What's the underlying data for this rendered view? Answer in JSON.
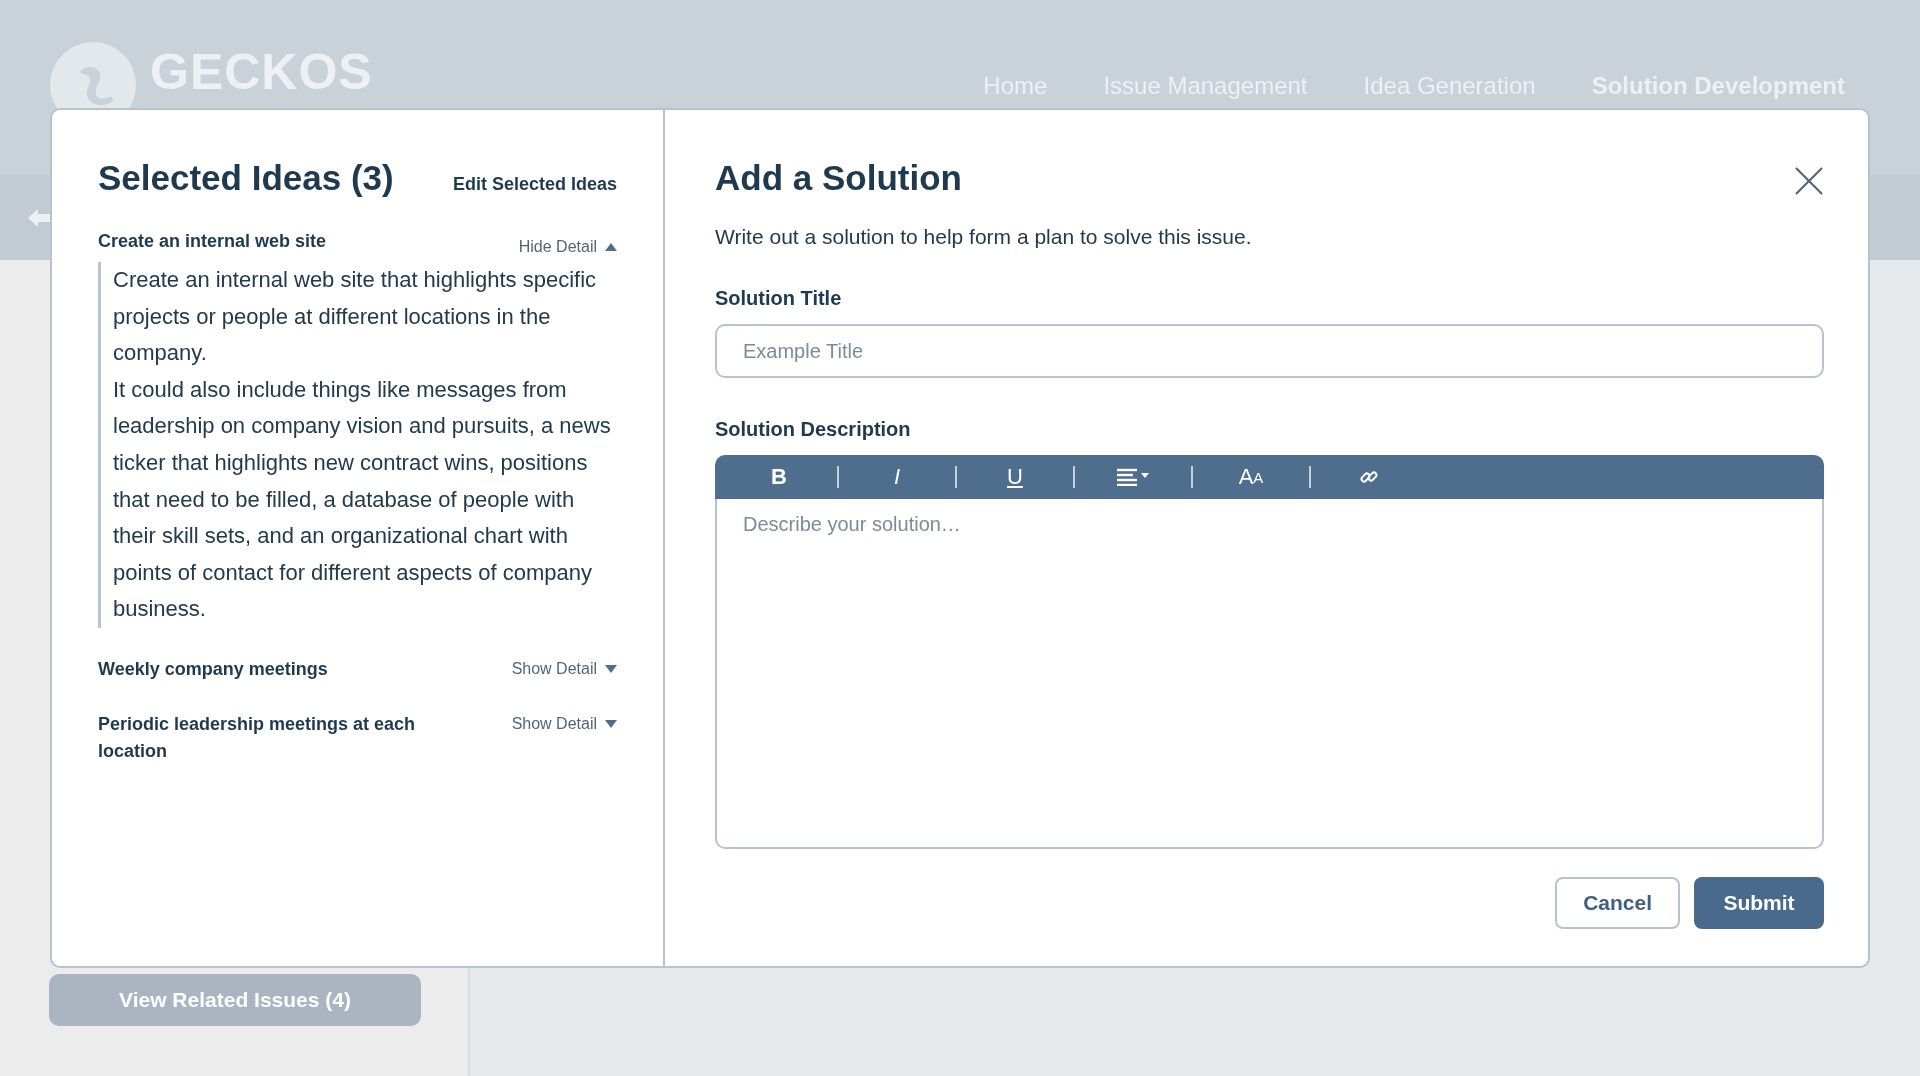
{
  "app": {
    "logo": "GECKOS",
    "nav": [
      {
        "label": "Home",
        "selected": false
      },
      {
        "label": "Issue Management",
        "selected": false
      },
      {
        "label": "Idea Generation",
        "selected": false
      },
      {
        "label": "Solution Development",
        "selected": true
      }
    ],
    "related_issues_button": "View Related Issues (4)"
  },
  "modal": {
    "selected_ideas": {
      "title": "Selected Ideas (3)",
      "edit_link": "Edit Selected Ideas",
      "ideas": [
        {
          "title": "Create an internal web site",
          "toggle": "Hide Detail",
          "expanded": true,
          "paragraphs": [
            "Create an internal web site that highlights specific projects or people at different locations in the company.",
            "It could also include things like messages from leadership on company vision and pursuits, a news ticker that highlights new contract wins, positions that need to be filled, a database of people with their skill sets, and an organizational chart with points of contact for different aspects of company business."
          ]
        },
        {
          "title": "Weekly company meetings",
          "toggle": "Show Detail",
          "expanded": false
        },
        {
          "title": "Periodic leadership meetings at each location",
          "toggle": "Show Detail",
          "expanded": false
        }
      ]
    },
    "form": {
      "title": "Add a Solution",
      "subtitle": "Write out a solution to help form a plan to solve this issue.",
      "title_label": "Solution Title",
      "title_field": {
        "placeholder": "Example Title"
      },
      "description_label": "Solution Description",
      "toolbar": [
        {
          "kind": "bold",
          "label": "B"
        },
        {
          "kind": "italic",
          "label": "I"
        },
        {
          "kind": "underline",
          "label": "U"
        },
        {
          "kind": "align"
        },
        {
          "kind": "font-size",
          "label": "A",
          "small_label": "A"
        },
        {
          "kind": "link"
        }
      ],
      "description_field": {
        "placeholder": "Describe your solution…"
      },
      "buttons": [
        {
          "kind": "secondary",
          "label": "Cancel"
        },
        {
          "kind": "primary",
          "label": "Submit"
        }
      ]
    }
  }
}
